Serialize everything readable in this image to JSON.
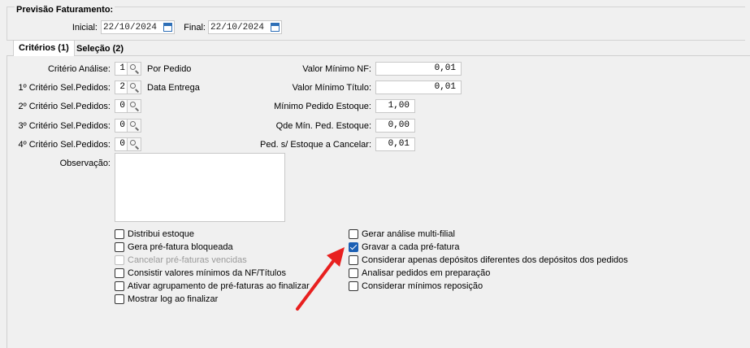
{
  "header": {
    "group_title": "Previsão Faturamento:",
    "inicial_label": "Inicial:",
    "inicial_value": "22/10/2024",
    "final_label": "Final:",
    "final_value": "22/10/2024"
  },
  "tabs": [
    {
      "label": "Critérios (1)",
      "active": true
    },
    {
      "label": "Seleção (2)",
      "active": false
    }
  ],
  "criterios": [
    {
      "label": "Critério Análise:",
      "code": "1",
      "description": "Por Pedido"
    },
    {
      "label": "1º Critério Sel.Pedidos:",
      "code": "2",
      "description": "Data Entrega"
    },
    {
      "label": "2º Critério Sel.Pedidos:",
      "code": "0",
      "description": ""
    },
    {
      "label": "3º Critério Sel.Pedidos:",
      "code": "0",
      "description": ""
    },
    {
      "label": "4º Critério Sel.Pedidos:",
      "code": "0",
      "description": ""
    }
  ],
  "valores": [
    {
      "label": "Valor Mínimo NF:",
      "value": "0,01"
    },
    {
      "label": "Valor Mínimo Título:",
      "value": "0,01"
    },
    {
      "label": "Mínimo Pedido Estoque:",
      "value": "1,00"
    },
    {
      "label": "Qde Mín. Ped. Estoque:",
      "value": "0,00"
    },
    {
      "label": "Ped. s/ Estoque a Cancelar:",
      "value": "0,01"
    }
  ],
  "observacao_label": "Observação:",
  "checkboxes_left": [
    {
      "label": "Distribui estoque",
      "checked": false,
      "disabled": false
    },
    {
      "label": "Gera pré-fatura bloqueada",
      "checked": false,
      "disabled": false
    },
    {
      "label": "Cancelar pré-faturas vencidas",
      "checked": false,
      "disabled": true
    },
    {
      "label": "Consistir valores mínimos da NF/Títulos",
      "checked": false,
      "disabled": false
    },
    {
      "label": "Ativar agrupamento de pré-faturas ao finalizar",
      "checked": false,
      "disabled": false
    },
    {
      "label": "Mostrar log ao finalizar",
      "checked": false,
      "disabled": false
    }
  ],
  "checkboxes_right": [
    {
      "label": "Gerar análise multi-filial",
      "checked": false,
      "disabled": false
    },
    {
      "label": "Gravar a cada pré-fatura",
      "checked": true,
      "disabled": false
    },
    {
      "label": "Considerar apenas depósitos diferentes dos depósitos dos pedidos",
      "checked": false,
      "disabled": false
    },
    {
      "label": "Analisar pedidos em preparação",
      "checked": false,
      "disabled": false
    },
    {
      "label": "Considerar mínimos reposição",
      "checked": false,
      "disabled": false
    }
  ],
  "colors": {
    "accent": "#1a5fb4",
    "arrow": "#e8201f"
  }
}
